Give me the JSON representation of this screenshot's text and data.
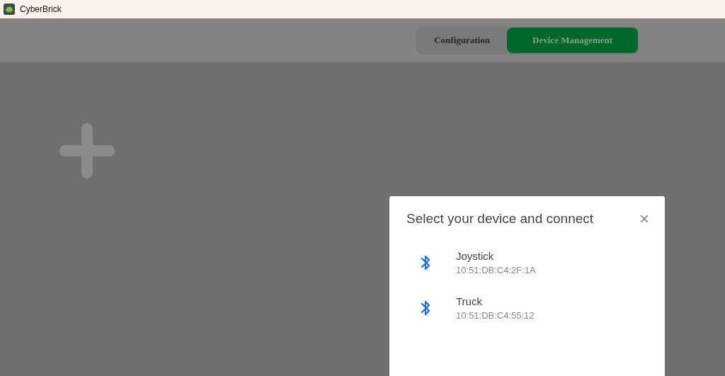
{
  "window": {
    "title": "CyberBrick"
  },
  "tabs": [
    {
      "label": "Configuration",
      "selected": false
    },
    {
      "label": "Device Management",
      "selected": true
    }
  ],
  "dialog": {
    "title": "Select your device and connect",
    "close": "×",
    "devices": [
      {
        "name": "Joystick",
        "address": "10:51:DB:C4:2F:1A"
      },
      {
        "name": "Truck",
        "address": "10:51:DB:C4:55:12"
      }
    ]
  }
}
